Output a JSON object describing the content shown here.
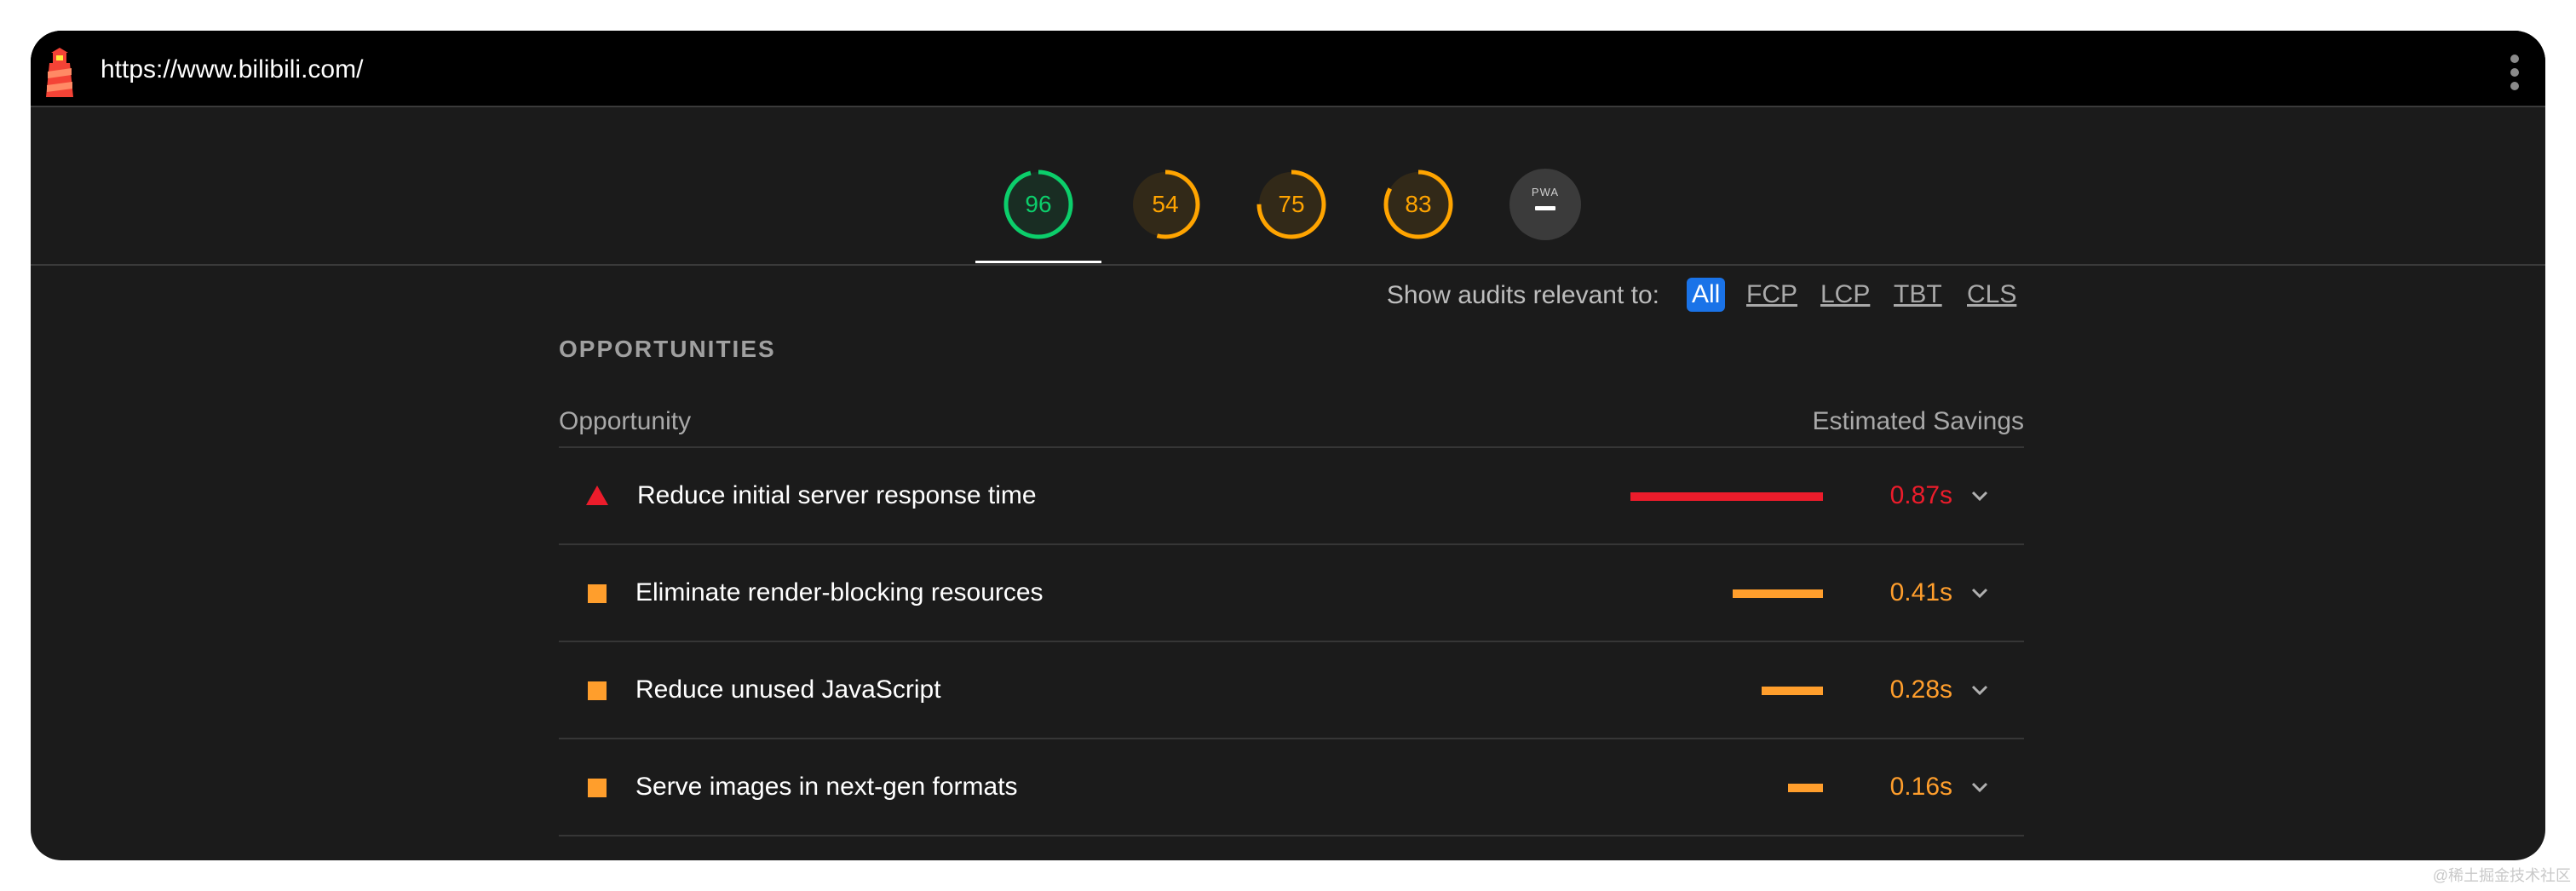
{
  "browser": {
    "url": "https://www.bilibili.com/",
    "logo_icon": "lighthouse-icon",
    "menu_icon": "kebab-menu-icon"
  },
  "gauges": [
    {
      "value": "96",
      "score": 0.96,
      "color": "#0cce6b",
      "active": true
    },
    {
      "value": "54",
      "score": 0.54,
      "color": "#ffa400",
      "active": false
    },
    {
      "value": "75",
      "score": 0.75,
      "color": "#ffa400",
      "active": false
    },
    {
      "value": "83",
      "score": 0.83,
      "color": "#ffa400",
      "active": false
    },
    {
      "value": "",
      "label": "PWA",
      "color": "#3b3b3b",
      "active": false
    }
  ],
  "filter": {
    "label": "Show audits relevant to:",
    "options": [
      "All",
      "FCP",
      "LCP",
      "TBT",
      "CLS"
    ],
    "selected": "All",
    "accent": "#1a73e8"
  },
  "opportunities": {
    "title": "OPPORTUNITIES",
    "col_left": "Opportunity",
    "col_right": "Estimated Savings",
    "rows": [
      {
        "title": "Reduce initial server response time",
        "savings": "0.87s",
        "severity": "fail",
        "color": "#ec1c2b",
        "bar_fraction": 1.0
      },
      {
        "title": "Eliminate render-blocking resources",
        "savings": "0.41s",
        "severity": "average",
        "color": "#ff9e2c",
        "bar_fraction": 0.47
      },
      {
        "title": "Reduce unused JavaScript",
        "savings": "0.28s",
        "severity": "average",
        "color": "#ff9e2c",
        "bar_fraction": 0.32
      },
      {
        "title": "Serve images in next-gen formats",
        "savings": "0.16s",
        "severity": "average",
        "color": "#ff9e2c",
        "bar_fraction": 0.18
      }
    ]
  },
  "watermark": "@稀土掘金技术社区"
}
